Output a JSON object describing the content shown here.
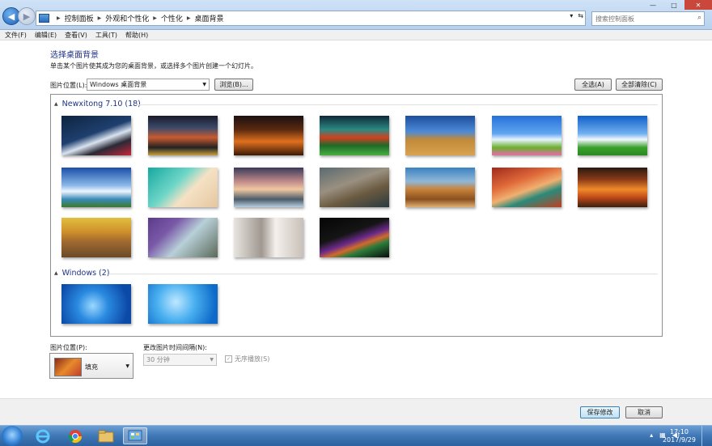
{
  "address": {
    "crumbs": [
      "控制面板",
      "外观和个性化",
      "个性化",
      "桌面背景"
    ],
    "search_placeholder": "搜索控制面板"
  },
  "window_buttons": {
    "minimize": "—",
    "maximize": "□",
    "close": "✕"
  },
  "menu": [
    "文件(F)",
    "编辑(E)",
    "查看(V)",
    "工具(T)",
    "帮助(H)"
  ],
  "page": {
    "heading": "选择桌面背景",
    "subtext": "单击某个图片使其成为您的桌面背景，或选择多个图片创建一个幻灯片。",
    "location_label": "图片位置(L):",
    "location_value": "Windows 桌面背景",
    "browse": "浏览(B)...",
    "select_all": "全选(A)",
    "clear_all": "全部清除(C)"
  },
  "groups": [
    {
      "title": "Newxitong 7.10 (18)"
    },
    {
      "title": "Windows (2)"
    }
  ],
  "thumbnails": [
    {
      "name": "anime-moon-night",
      "bg": "linear-gradient(160deg,#0d2440 0%,#1f3f6e 45%,#d9e3f0 60%,#2a2a35 75%,#c8243b 100%)"
    },
    {
      "name": "city-street-night",
      "bg": "linear-gradient(180deg,#1a1a2a 0%,#3a4a6a 30%,#c85a30 55%,#222 80%,#c9a040 100%)"
    },
    {
      "name": "sunset-grass",
      "bg": "linear-gradient(180deg,#1c1010 0%,#5a2a10 35%,#e0701e 65%,#3a1a08 100%)"
    },
    {
      "name": "green-road-sunset",
      "bg": "linear-gradient(180deg,#102838 0%,#2a8a84 35%,#d04020 55%,#1d6a2a 75%,#4ab040 100%)"
    },
    {
      "name": "hay-bale-field",
      "bg": "linear-gradient(180deg,#1d4f9c 0%,#4c8ad8 40%,#c08a3a 60%,#d9a250 100%)"
    },
    {
      "name": "daisy-meadow",
      "bg": "linear-gradient(180deg,#2670d8 0%,#60a6f0 45%,#e8f4ff 60%,#6ab02e 80%,#e86aa8 100%)"
    },
    {
      "name": "green-field-sky",
      "bg": "linear-gradient(180deg,#1160c8 0%,#70b0f0 45%,#f4f8ff 60%,#3aa02c 80%,#2a8a22 100%)"
    },
    {
      "name": "wind-turbine-coast",
      "bg": "linear-gradient(180deg,#1a4ea8 0%,#8ab8e8 45%,#f0f6ff 60%,#3a8ab8 80%,#3c7a2c 100%)"
    },
    {
      "name": "beach-aerial",
      "bg": "linear-gradient(135deg,#17a8a0 0%,#6fd6c8 40%,#f4e2c4 60%,#e6c6a0 100%)"
    },
    {
      "name": "coast-rocks-sunset",
      "bg": "linear-gradient(180deg,#3a3a58 0%,#c08a8a 35%,#f0c8a0 55%,#4a5a6a 80%,#b8d0e0 100%)"
    },
    {
      "name": "cliff-waterfall",
      "bg": "linear-gradient(160deg,#5a6a70 0%,#9a9080 40%,#6a5a40 65%,#2a3a40 100%)"
    },
    {
      "name": "pyramids-dunes",
      "bg": "linear-gradient(180deg,#3a82c0 0%,#90b8d8 35%,#c8823a 55%,#8a5020 80%,#e0b070 100%)"
    },
    {
      "name": "red-canyon-river",
      "bg": "linear-gradient(160deg,#a02a1a 0%,#e06a3a 35%,#f0b070 55%,#2a8a7a 70%,#c04020 100%)"
    },
    {
      "name": "sunset-lake-trees",
      "bg": "linear-gradient(180deg,#2a1a10 0%,#8a3a18 30%,#f08a2a 55%,#c04a1a 75%,#3a2010 100%)"
    },
    {
      "name": "autumn-flood-trees",
      "bg": "linear-gradient(180deg,#e0c040 0%,#d0902a 35%,#a06a30 60%,#6a4a28 100%)"
    },
    {
      "name": "chainlink-fence-hand",
      "bg": "linear-gradient(135deg,#5a3a8a 0%,#7a5aa8 30%,#b8d0d8 55%,#5a6a5a 100%)"
    },
    {
      "name": "girl-window",
      "bg": "linear-gradient(90deg,#e8e4e0 0%,#a09890 40%,#f4f0ec 60%,#c8c0b8 100%)"
    },
    {
      "name": "rainbow-dark",
      "bg": "linear-gradient(160deg,#050505 0%,#151515 40%,#6a2a8a 55%,#d06a2a 65%,#2a7a3a 75%,#0a0a0a 100%)"
    },
    {
      "name": "windows7-logo",
      "bg": "radial-gradient(circle at 45% 55%,#9ad8ff 0%,#2a8ae0 35%,#0c4aa8 80%)"
    },
    {
      "name": "windows-daisies",
      "bg": "radial-gradient(circle at 40% 45%,#bfe8ff 0%,#4ab0f0 40%,#0d6ac8 85%)"
    }
  ],
  "bottom": {
    "position_label": "图片位置(P):",
    "position_value": "填充",
    "interval_label": "更改图片时间间隔(N):",
    "interval_value": "30 分钟",
    "shuffle_label": "无序播放(S)",
    "save": "保存修改",
    "cancel": "取消"
  },
  "taskbar": {
    "time": "17:10",
    "date": "2017/9/29"
  }
}
